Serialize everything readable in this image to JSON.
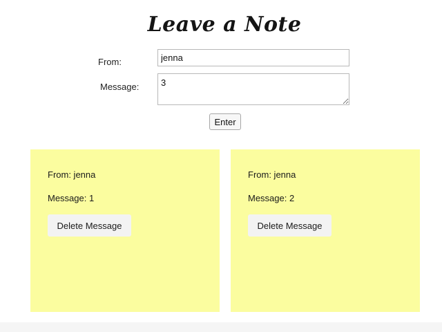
{
  "page": {
    "title": "Leave a Note"
  },
  "form": {
    "from_label": "From:",
    "from_value": "jenna",
    "message_label": "Message:",
    "message_value": "3",
    "enter_label": "Enter"
  },
  "notes": [
    {
      "from_text": "From: jenna",
      "message_text": "Message: 1",
      "delete_label": "Delete Message"
    },
    {
      "from_text": "From: jenna",
      "message_text": "Message: 2",
      "delete_label": "Delete Message"
    }
  ],
  "colors": {
    "note_background": "#fbfd9f",
    "page_background": "#ffffff"
  }
}
